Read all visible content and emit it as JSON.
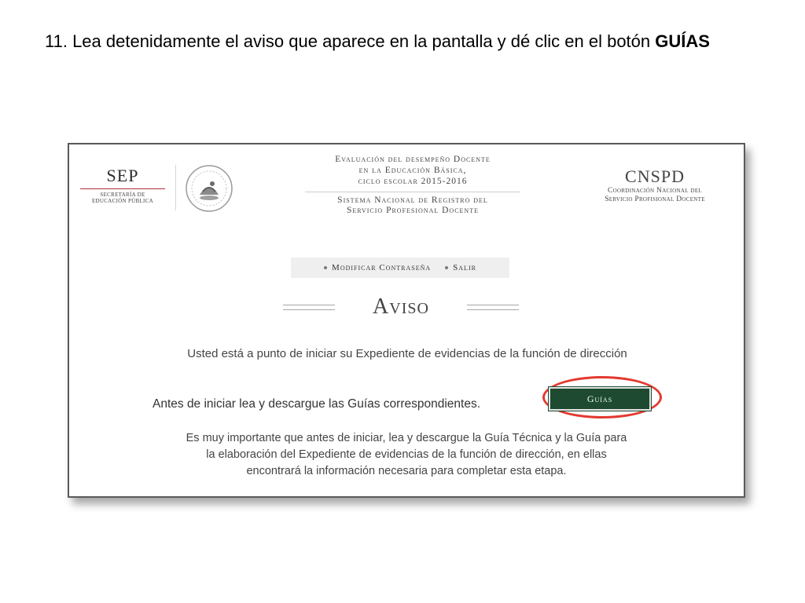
{
  "instruction": {
    "text": "11. Lea detenidamente el aviso que aparece en la pantalla y dé clic en el botón ",
    "bold": "GUÍAS"
  },
  "header": {
    "sep_logo": {
      "title": "SEP",
      "subtitle_line1": "SECRETARÍA DE",
      "subtitle_line2": "EDUCACIÓN PÚBLICA"
    },
    "seal_icon": "mexican-coat-of-arms-icon",
    "center": {
      "line1": "Evaluación del desempeño Docente",
      "line2": "en la Educación Básica,",
      "line3": "ciclo escolar 2015-2016",
      "line4": "Sistema Nacional de Registro del",
      "line5": "Servicio Profesional Docente"
    },
    "cnspd_logo": {
      "title": "CNSPD",
      "subtitle_line1": "Coordinación Nacional del",
      "subtitle_line2": "Servicio Profisional Docente"
    }
  },
  "menu": {
    "items": [
      {
        "label": "Modificar Contraseña"
      },
      {
        "label": "Salir"
      }
    ]
  },
  "aviso": {
    "title": "Aviso",
    "line1": "Usted está a punto de iniciar su Expediente de evidencias de la función de dirección",
    "line2": "Antes de iniciar lea y descargue las Guías correspondientes.",
    "guias_button": "Guías",
    "line3": "Es muy importante que antes de iniciar, lea y descargue la Guía Técnica y la Guía para",
    "line4": "la elaboración del Expediente de evidencias de la función de dirección, en ellas",
    "line5": "encontrará la información necesaria para completar esta etapa."
  },
  "colors": {
    "button_green": "#1d4a30",
    "highlight_red": "#e23a2f",
    "frame_border": "#5a5a5a"
  }
}
